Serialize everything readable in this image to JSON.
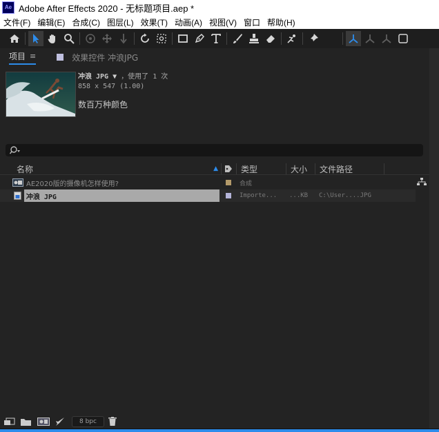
{
  "window": {
    "app_icon_text": "Ae",
    "title": "Adobe After Effects 2020 - 无标题项目.aep *"
  },
  "menu": [
    "文件(F)",
    "编辑(E)",
    "合成(C)",
    "图层(L)",
    "效果(T)",
    "动画(A)",
    "视图(V)",
    "窗口",
    "帮助(H)"
  ],
  "tabs": {
    "project": "项目",
    "effects": "效果控件 冲浪JPG"
  },
  "preview_info": {
    "name": "冲浪 JPG",
    "usage": "，使用了 1 次",
    "dimensions": "858 x 547 (1.00)",
    "colors": "数百万种颜色"
  },
  "search": {
    "placeholder": ""
  },
  "columns": {
    "name": "名称",
    "type": "类型",
    "size": "大小",
    "path": "文件路径"
  },
  "items": [
    {
      "name": "AE2020版的摄像机怎样使用?",
      "type": "合成",
      "size": "",
      "path": "",
      "label_color": "#b39a6a"
    },
    {
      "name": "冲浪 JPG",
      "type": "Importe...",
      "size": "...KB",
      "path": "C:\\User....JPG",
      "label_color": "#b4b4d8"
    }
  ],
  "bottom": {
    "bpc": "8 bpc"
  },
  "icons": {
    "home": "home-icon",
    "selection": "arrow-icon",
    "hand": "hand-icon",
    "zoom": "zoom-icon",
    "rotate": "rotate-icon",
    "camera": "camera-icon",
    "pan": "pan-icon",
    "shape": "rectangle-icon",
    "pen": "pen-icon",
    "text": "text-icon",
    "brush": "brush-icon",
    "stamp": "stamp-icon",
    "eraser": "eraser-icon",
    "roto": "roto-brush-icon",
    "puppet": "puppet-pin-icon"
  }
}
